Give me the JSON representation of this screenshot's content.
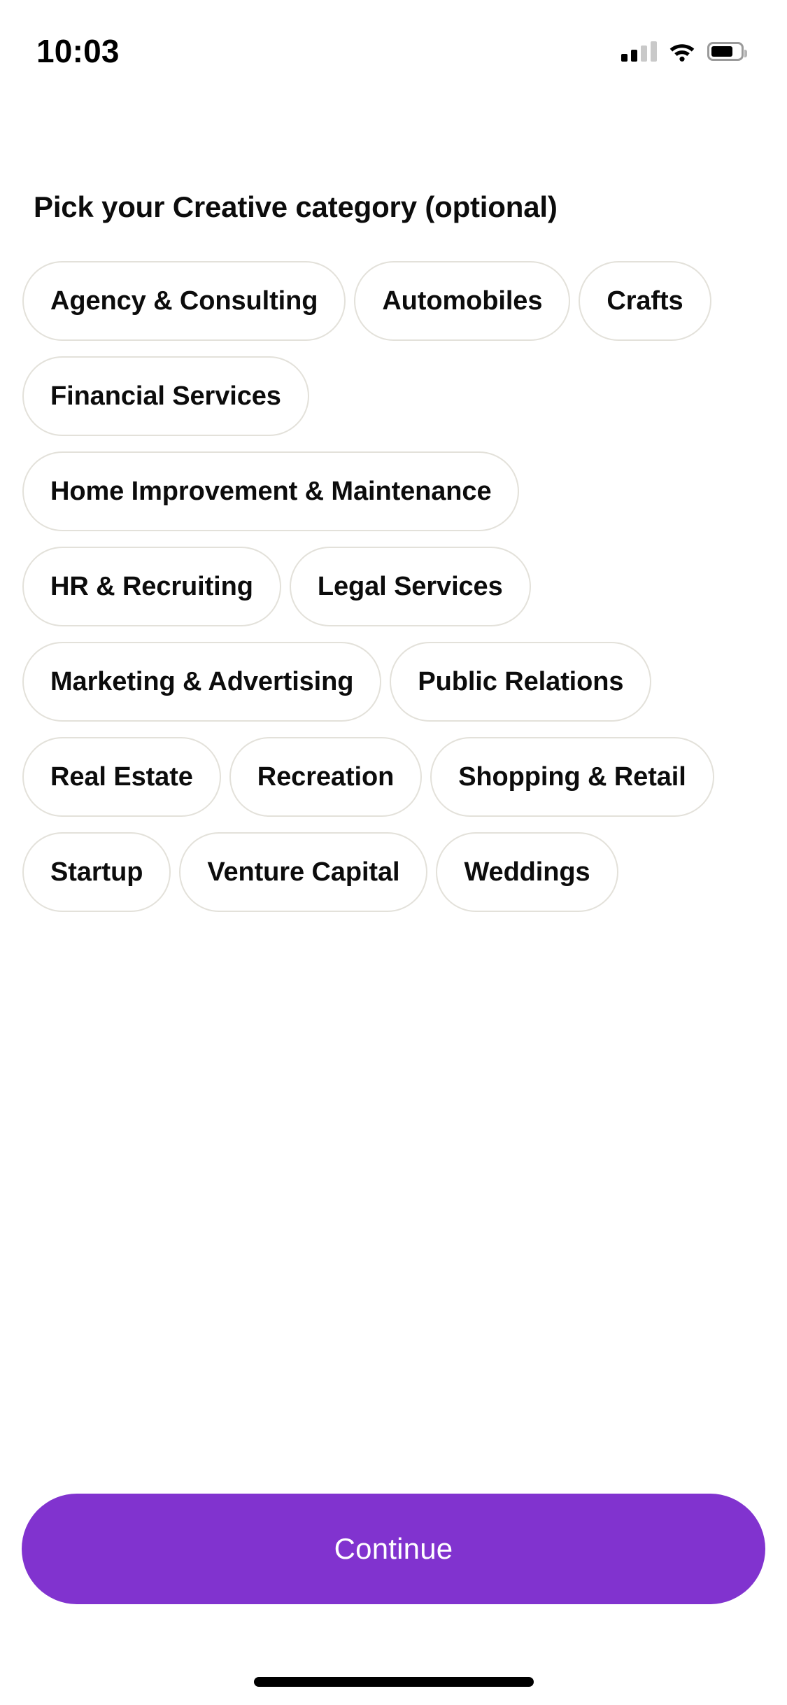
{
  "status_bar": {
    "time": "10:03",
    "signal_icon": "cellular-signal-icon",
    "wifi_icon": "wifi-icon",
    "battery_icon": "battery-icon",
    "signal_bars_filled": 2,
    "signal_bars_total": 4,
    "battery_level_percent": 66
  },
  "page": {
    "heading": "Pick your Creative category (optional)"
  },
  "categories": [
    {
      "label": "Agency & Consulting",
      "selected": false
    },
    {
      "label": "Automobiles",
      "selected": false
    },
    {
      "label": "Crafts",
      "selected": false
    },
    {
      "label": "Financial Services",
      "selected": false
    },
    {
      "label": "Home Improvement & Maintenance",
      "selected": false
    },
    {
      "label": "HR & Recruiting",
      "selected": false
    },
    {
      "label": "Legal Services",
      "selected": false
    },
    {
      "label": "Marketing & Advertising",
      "selected": false
    },
    {
      "label": "Public Relations",
      "selected": false
    },
    {
      "label": "Real Estate",
      "selected": false
    },
    {
      "label": "Recreation",
      "selected": false
    },
    {
      "label": "Shopping & Retail",
      "selected": false
    },
    {
      "label": "Startup",
      "selected": false
    },
    {
      "label": "Venture Capital",
      "selected": false
    },
    {
      "label": "Weddings",
      "selected": false
    }
  ],
  "footer": {
    "continue_label": "Continue",
    "continue_color": "#8133cf",
    "home_indicator": "home-indicator"
  },
  "colors": {
    "background": "#ffffff",
    "text": "#0c0c0c",
    "chip_border": "#e3e1da",
    "accent_purple": "#8133cf"
  }
}
